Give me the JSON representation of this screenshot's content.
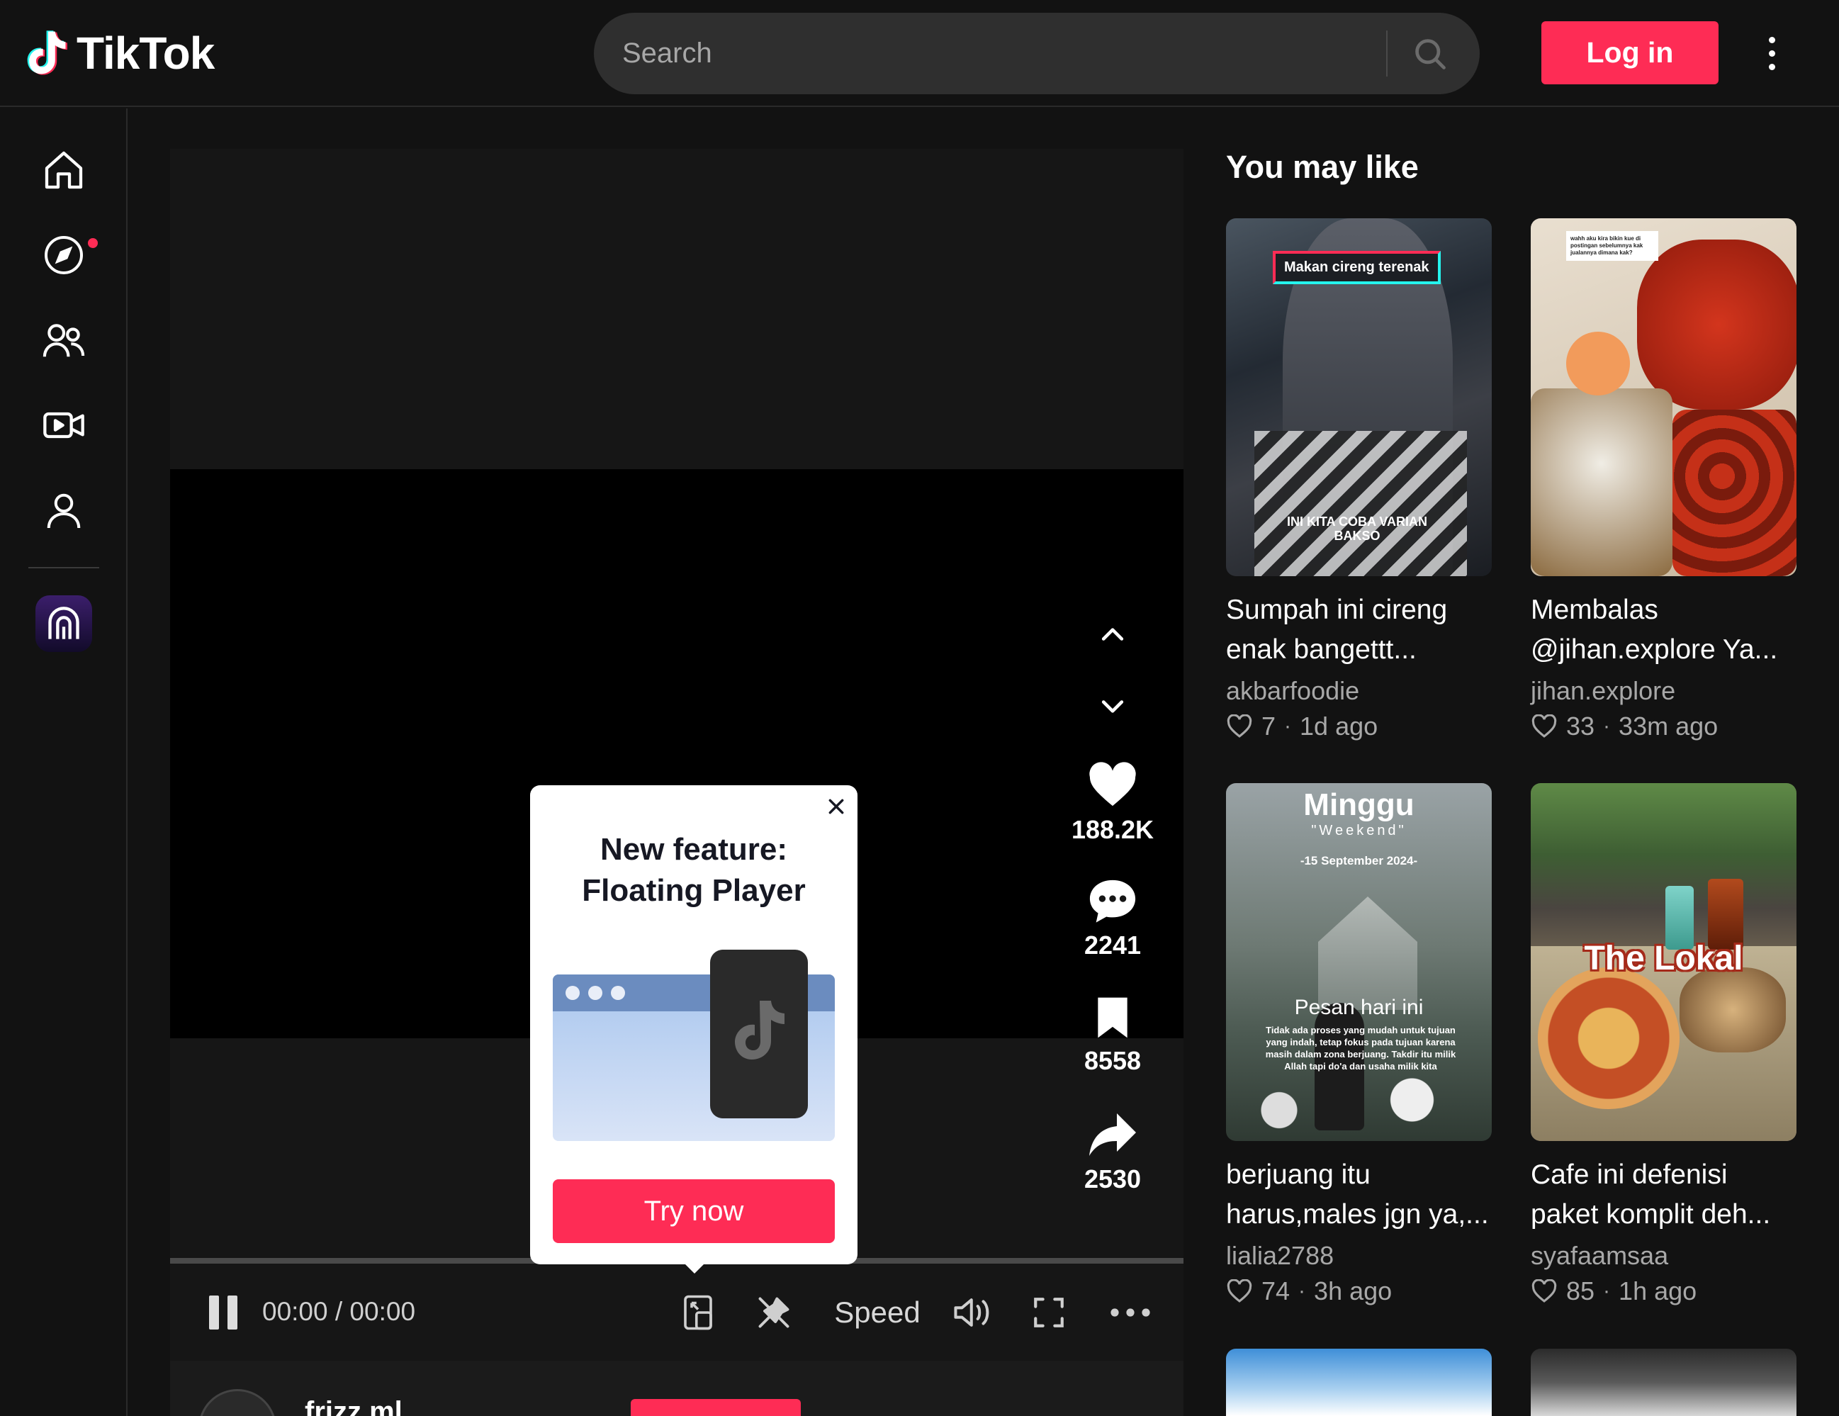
{
  "header": {
    "logo_text": "TikTok",
    "search_placeholder": "Search",
    "login_label": "Log in"
  },
  "sidebar": {
    "items": [
      "home",
      "explore",
      "following",
      "live",
      "profile"
    ]
  },
  "video": {
    "actions": {
      "likes": "188.2K",
      "comments": "2241",
      "saves": "8558",
      "shares": "2530"
    },
    "time": "00:00 / 00:00",
    "speed_label": "Speed",
    "author_name": "frizz.ml"
  },
  "popup": {
    "title_line1": "New feature:",
    "title_line2": "Floating Player",
    "button_label": "Try now"
  },
  "recommendations": {
    "heading": "You may like",
    "cards": [
      {
        "title_line1": "Sumpah ini cireng",
        "title_line2": "enak bangettt...",
        "author": "akbarfoodie",
        "likes": "7",
        "age": "1d ago",
        "overlay_top": "Makan cireng terenak",
        "overlay_bottom": "INI KITA COBA VARIAN BAKSO"
      },
      {
        "title_line1": "Membalas",
        "title_line2": "@jihan.explore Ya...",
        "author": "jihan.explore",
        "likes": "33",
        "age": "33m ago",
        "overlay_top": "wahh aku kira bikin kue di postingan sebelumnya kak jualannya dimana kak?"
      },
      {
        "title_line1": "berjuang itu",
        "title_line2": "harus,males jgn ya,...",
        "author": "lialia2788",
        "likes": "74",
        "age": "3h ago",
        "overlay_title": "Minggu",
        "overlay_sub": "\"Weekend\"",
        "overlay_date": "-15 September 2024-",
        "overlay_mid": "Pesan hari ini",
        "overlay_body": "Tidak ada proses yang mudah untuk tujuan yang indah, tetap fokus pada tujuan karena masih dalam zona berjuang. Takdir itu milik Allah tapi do'a dan usaha milik kita"
      },
      {
        "title_line1": "Cafe ini defenisi",
        "title_line2": "paket komplit deh...",
        "author": "syafaamsaa",
        "likes": "85",
        "age": "1h ago",
        "overlay_title": "The Lokal"
      }
    ]
  },
  "colors": {
    "accent": "#fe2c55",
    "background": "#121212",
    "panel": "#161616"
  }
}
